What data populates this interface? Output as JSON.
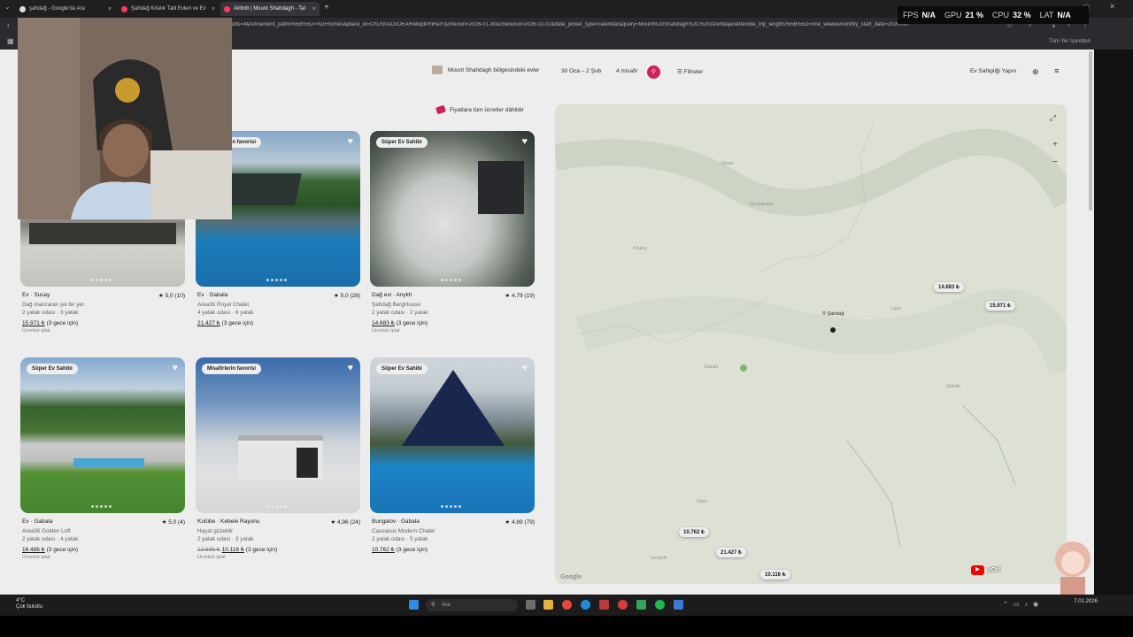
{
  "browser": {
    "tabs": [
      {
        "title": "şahdağ - Google'da Ara",
        "active": false
      },
      {
        "title": "Şahdağ Kiralık Tatil Evleri ve Ev",
        "active": false
      },
      {
        "title": "Airbnb | Mount Shahdagh - Tat",
        "active": true
      }
    ],
    "url": "ults=4&refinement_paths%5B%5D=%2Fhomes&place_id=ChIJS0ADsOEARwkqdPmRalY&checkin=2026-01-30&checkout=2026-02-02&date_picker_type=calendar&query=Mount%20Shahdagh%2C%20Azerbaijan&flexible_trip_lengths%5B%5D=one_week&monthly_start_date=2026-02-",
    "all_bookmarks": "Tüm Yer İşaretleri"
  },
  "perf": {
    "fps_label": "FPS",
    "fps": "N/A",
    "gpu_label": "GPU",
    "gpu": "21 %",
    "cpu_label": "CPU",
    "cpu": "32 %",
    "lat_label": "LAT",
    "lat": "N/A"
  },
  "header": {
    "location": "Mount Shahdagh bölgesindeki evler",
    "dates": "30 Oca – 2 Şub",
    "guests": "4 misafir",
    "filters": "Filtreler",
    "host": "Ev Sahipliği Yapın"
  },
  "price_banner": "Fiyatlara tüm ücretler dâhildir",
  "listings": [
    {
      "badge": "",
      "title": "Ev · Susay",
      "rating": "★ 5,0 (10)",
      "line2": "Dağ manzaralı şık bir yer.",
      "line3": "2 yatak odası · 3 yatak",
      "price": "15.971 ₺",
      "price_note": " (3 gece için)",
      "old_price": "",
      "free": "Ücretsiz iptal"
    },
    {
      "badge": "Misafirlerin favorisi",
      "title": "Ev · Gabala",
      "rating": "★ 5,0 (28)",
      "line2": "Area36 Royal Chalet",
      "line3": "4 yatak odası · 6 yatak",
      "price": "21.427 ₺",
      "price_note": " (3 gece için)",
      "old_price": "",
      "free": ""
    },
    {
      "badge": "Süper Ev Sahibi",
      "title": "Dağ evi · Anykh",
      "rating": "★ 4,79 (19)",
      "line2": "Şahdağ BergHouse",
      "line3": "2 yatak odası · 2 yatak",
      "price": "14.683 ₺",
      "price_note": " (3 gece için)",
      "old_price": "",
      "free": "Ücretsiz iptal"
    },
    {
      "badge": "Süper Ev Sahibi",
      "title": "Ev · Gabala",
      "rating": "★ 5,0 (4)",
      "line2": "Area36 Golden Loft",
      "line3": "2 yatak odası · 4 yatak",
      "price": "16.486 ₺",
      "price_note": " (3 gece için)",
      "old_price": "",
      "free": "Ücretsiz iptal"
    },
    {
      "badge": "Misafirlerin favorisi",
      "title": "Kulübe · Kebele Rayonu",
      "rating": "★ 4,96 (24)",
      "line2": "Hayat güzeldir",
      "line3": "2 yatak odası · 3 yatak",
      "price": "10.116 ₺",
      "price_note": " (3 gece için)",
      "old_price": "12.696 ₺",
      "free": "Ücretsiz iptal"
    },
    {
      "badge": "Süper Ev Sahibi",
      "title": "Bungalov · Gabala",
      "rating": "★ 4,89 (79)",
      "line2": "Caucasus Modern Chalet",
      "line3": "2 yatak odası · 5 yatak",
      "price": "10.762 ₺",
      "price_note": " (3 gece için)",
      "old_price": "",
      "free": ""
    }
  ],
  "map": {
    "pins": [
      "14.683 ₺",
      "15.971 ₺",
      "10.762 ₺",
      "21.427 ₺",
      "10.116 ₺"
    ],
    "place": "Şahdağ",
    "labels": [
      "Qusar",
      "Qonaqkənd",
      "Xınalıq",
      "Laza",
      "Gabala",
      "Qəbələ",
      "Oğuz",
      "İsmayıllı"
    ],
    "attribution": "Google"
  },
  "overlays": {
    "youtube_text": "yOrl"
  },
  "taskbar": {
    "weather_temp": "4°C",
    "weather_desc": "Çok bulutlu",
    "search": "Ara",
    "time": "",
    "date": "7.01.2026"
  }
}
